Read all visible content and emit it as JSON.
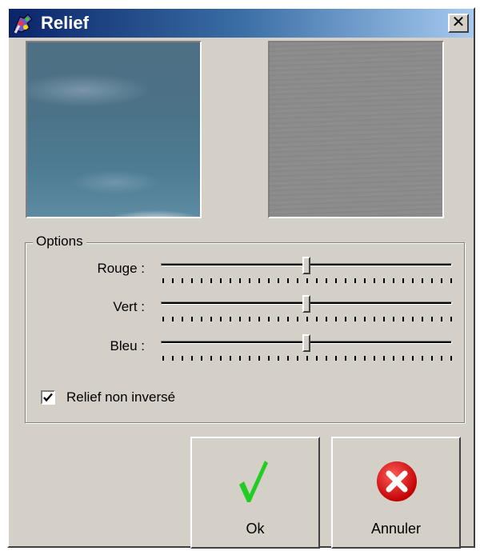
{
  "window": {
    "title": "Relief",
    "close_label": "✕"
  },
  "options": {
    "group_label": "Options",
    "sliders": [
      {
        "label": "Rouge :",
        "value": 0.5
      },
      {
        "label": "Vert :",
        "value": 0.5
      },
      {
        "label": "Bleu :",
        "value": 0.5
      }
    ],
    "checkbox": {
      "label": "Relief non inversé",
      "checked": true
    }
  },
  "buttons": {
    "ok_label": "Ok",
    "cancel_label": "Annuler"
  },
  "colors": {
    "ok_check": "#22cc22",
    "cancel_circle": "#e60000",
    "title_gradient_start": "#0a246a",
    "title_gradient_end": "#a6caf0"
  }
}
